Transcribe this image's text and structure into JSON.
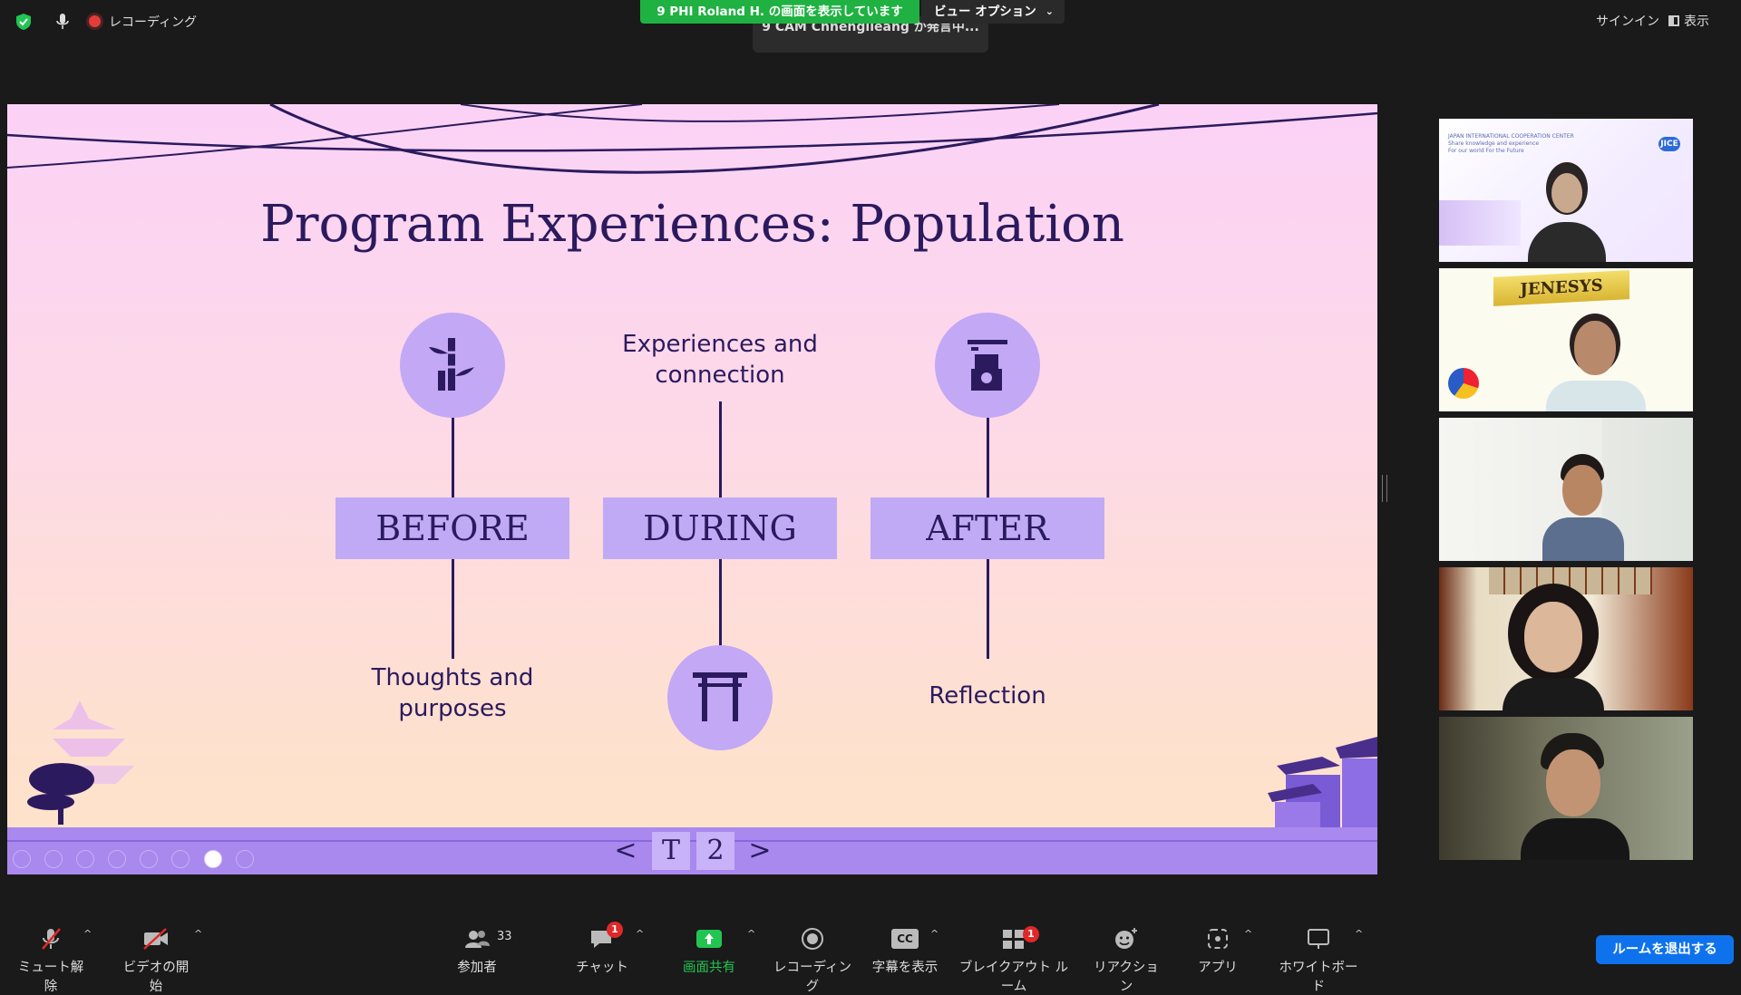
{
  "topbar": {
    "recording_label": "レコーディング",
    "share_banner": "9 PHI Roland H. の画面を表示しています",
    "view_options": "ビュー オプション",
    "speaking_indicator": "9 CAM Chhenglieang が発言中...",
    "signin": "サインイン",
    "view": "表示"
  },
  "slide": {
    "title": "Program Experiences: Population",
    "phases": [
      "BEFORE",
      "DURING",
      "AFTER"
    ],
    "captions": {
      "before": [
        "Thoughts and",
        "purposes"
      ],
      "during": [
        "Experiences and",
        "connection"
      ],
      "after": [
        "Reflection"
      ]
    },
    "nav": {
      "prev": "<",
      "t": "T",
      "page": "2",
      "next": ">"
    }
  },
  "participants": {
    "tile1_org_text": [
      "JAPAN INTERNATIONAL COOPERATION CENTER",
      "Share knowledge and experience",
      "For our world For the Future"
    ],
    "tile1_logo": "JICE",
    "tile2_banner": "JENESYS"
  },
  "toolbar": {
    "unmute": "ミュート解除",
    "start_video": "ビデオの開始",
    "participants": "参加者",
    "participants_count": "33",
    "chat": "チャット",
    "chat_badge": "1",
    "share_screen": "画面共有",
    "recording": "レコーディング",
    "captions": "字幕を表示",
    "captions_icon": "CC",
    "breakout": "ブレイクアウト ルーム",
    "breakout_badge": "1",
    "reactions": "リアクション",
    "apps": "アプリ",
    "whiteboard": "ホワイトボード",
    "leave_room": "ルームを退出する"
  },
  "colors": {
    "share_green": "#1fb142",
    "leave_blue": "#0e72ed",
    "slide_ink": "#2b1a5e",
    "slide_lavender": "#c0aaf5"
  }
}
